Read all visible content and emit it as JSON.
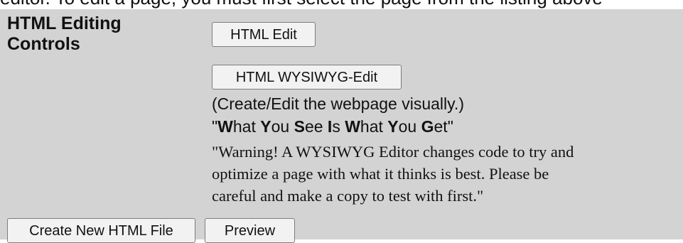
{
  "header": {
    "cut_off_text": "editor. To edit a page, you must first select the page from the listing above"
  },
  "controls": {
    "label": "HTML Editing Controls",
    "html_edit_button": "HTML Edit",
    "wysiwyg_edit_button": "HTML WYSIWYG-Edit",
    "description": "(Create/Edit the webpage visually.)",
    "motto_parts": [
      "\"",
      "W",
      "hat ",
      "Y",
      "ou ",
      "S",
      "ee ",
      "I",
      "s ",
      "W",
      "hat ",
      "Y",
      "ou ",
      "G",
      "et\""
    ],
    "warning_lines": [
      "\"Warning! A WYSIWYG Editor changes code to try and",
      "optimize a page with what it thinks is best. Please be",
      "careful and make a copy to test with first.\""
    ]
  },
  "footer": {
    "create_button": "Create New HTML File",
    "preview_button": "Preview"
  },
  "colors": {
    "panel_background": "#d3d3d3",
    "button_background": "#f2f2f2",
    "button_border": "#7d7d7d",
    "text": "#111111"
  }
}
